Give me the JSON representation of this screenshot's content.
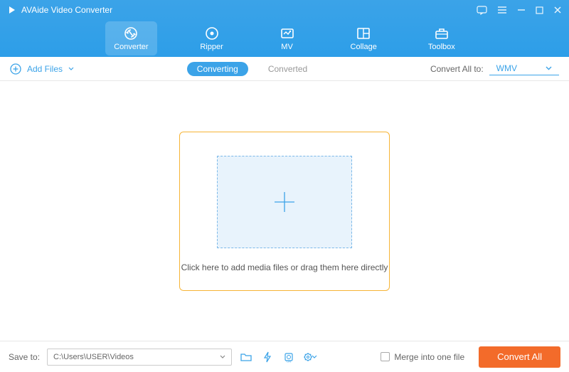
{
  "app": {
    "title": "AVAide Video Converter"
  },
  "nav": {
    "converter": "Converter",
    "ripper": "Ripper",
    "mv": "MV",
    "collage": "Collage",
    "toolbox": "Toolbox"
  },
  "toolbar": {
    "add_files": "Add Files",
    "converting": "Converting",
    "converted": "Converted",
    "convert_all_to": "Convert All to:",
    "format": "WMV"
  },
  "dropzone": {
    "text": "Click here to add media files or drag them here directly"
  },
  "footer": {
    "save_to_label": "Save to:",
    "path": "C:\\Users\\USER\\Videos",
    "merge_label": "Merge into one file",
    "convert_button": "Convert All"
  }
}
